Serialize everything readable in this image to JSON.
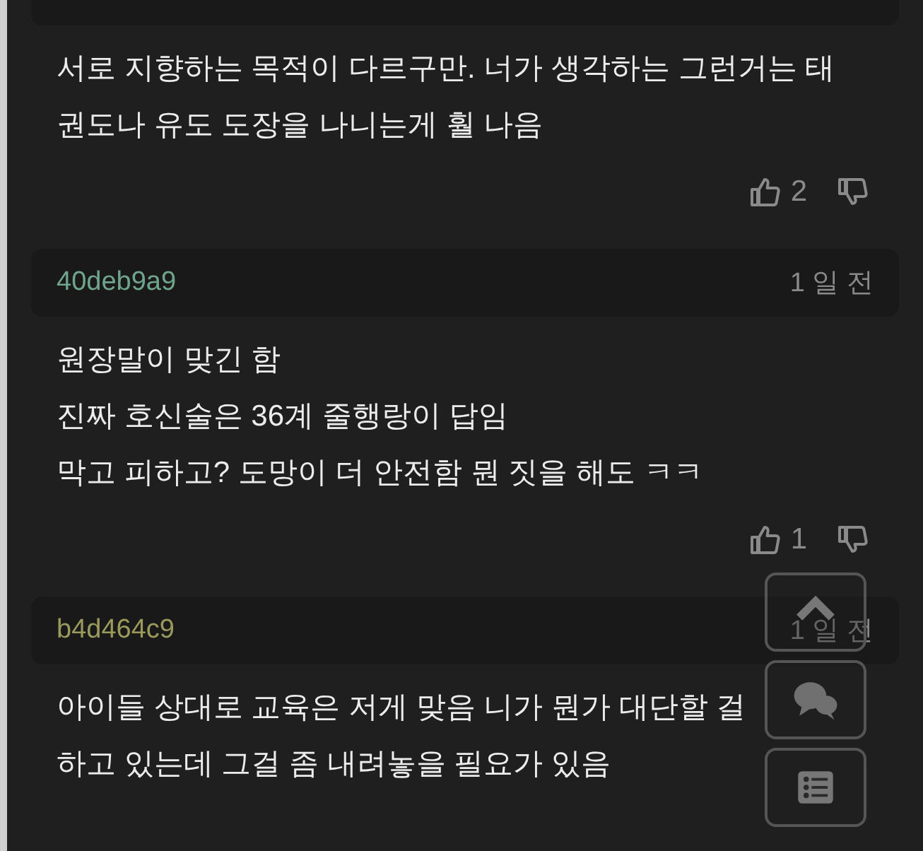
{
  "comments": [
    {
      "body": [
        "서로 지향하는 목적이 다르구만. 너가 생각하는 그런거는 태",
        "권도나 유도 도장을 나니는게 훨 나음"
      ],
      "likes": "2"
    },
    {
      "username": "40deb9a9",
      "color": "#6fa58c",
      "time": "1 일 전",
      "body": [
        "원장말이 맞긴 함",
        "진짜 호신술은 36계 줄행랑이 답임",
        "막고 피하고? 도망이 더 안전함 뭔 짓을 해도 ㅋㅋ"
      ],
      "likes": "1"
    },
    {
      "username": "b4d464c9",
      "color": "#9a9a5c",
      "time": "1 일 전",
      "body": [
        "아이들 상대로 교육은 저게 맞음 니가 뭔가 대단할 걸",
        "하고 있는데 그걸 좀 내려놓을 필요가 있음"
      ]
    }
  ],
  "floating_buttons": [
    {
      "kind": "top"
    },
    {
      "kind": "comments"
    },
    {
      "kind": "list"
    }
  ]
}
